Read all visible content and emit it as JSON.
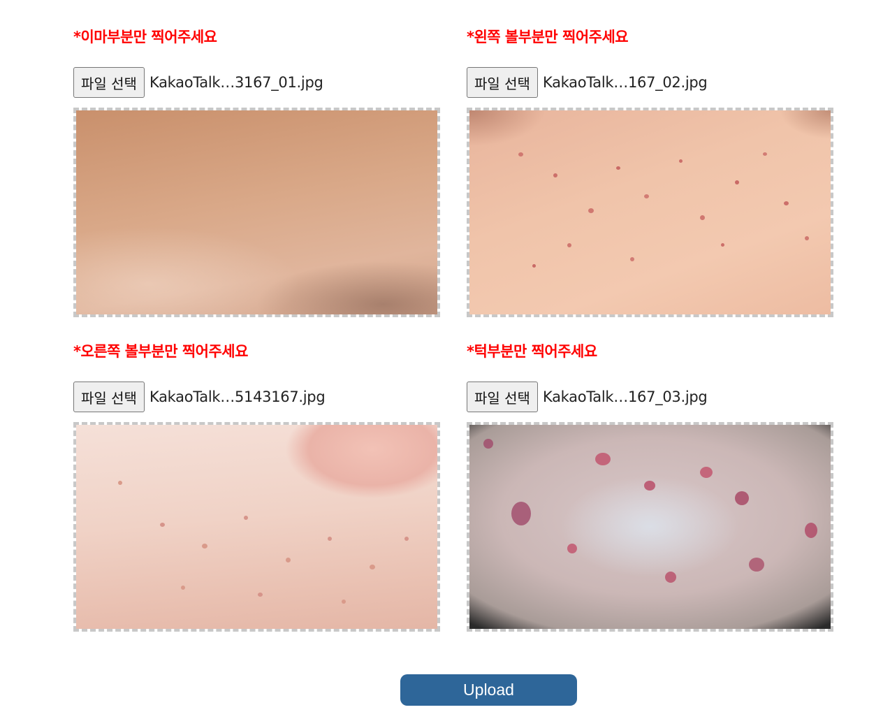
{
  "sections": [
    {
      "title": "*이마부분만 찍어주세요",
      "button_label": "파일 선택",
      "file_name": "KakaoTalk…3167_01.jpg"
    },
    {
      "title": "*왼쪽 볼부분만 찍어주세요",
      "button_label": "파일 선택",
      "file_name": "KakaoTalk…167_02.jpg"
    },
    {
      "title": "*오른쪽 볼부분만 찍어주세요",
      "button_label": "파일 선택",
      "file_name": "KakaoTalk…5143167.jpg"
    },
    {
      "title": "*턱부분만 찍어주세요",
      "button_label": "파일 선택",
      "file_name": "KakaoTalk…167_03.jpg"
    }
  ],
  "upload": {
    "label": "Upload"
  },
  "colors": {
    "title_red": "#ff0000",
    "upload_blue": "#2e6699",
    "preview_border": "#c8c8c8"
  }
}
